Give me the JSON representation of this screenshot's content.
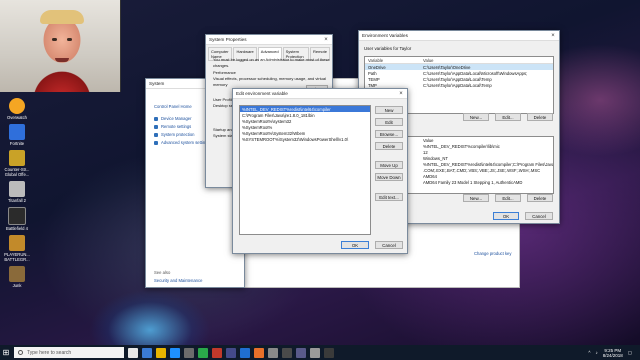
{
  "desktop_icons": [
    {
      "label": "Overwatch",
      "color": "#f5a623"
    },
    {
      "label": "Fortnite",
      "color": "#2f6fdb"
    },
    {
      "label": "Counter-Str... Global Offe...",
      "color": "#c9a227"
    },
    {
      "label": "Titanfall 2",
      "color": "#bcbcbc"
    },
    {
      "label": "Battlefield 4",
      "color": "#2b2b2b"
    },
    {
      "label": "PLAYERUN... BATTLEGR...",
      "color": "#c28a2a"
    },
    {
      "label": "Junk",
      "color": "#8a6a3a"
    }
  ],
  "system_window": {
    "title": "System",
    "home": "Control Panel Home",
    "nav": [
      "Device Manager",
      "Remote settings",
      "System protection",
      "Advanced system settings"
    ],
    "see_also": "See also",
    "security": "Security and Maintenance"
  },
  "sys_main": {
    "win_label": "Windows",
    "activation": "Windows",
    "change_key": "Change product key"
  },
  "system_properties": {
    "title": "System Properties",
    "tabs": [
      "Computer Name",
      "Hardware",
      "Advanced",
      "System Protection",
      "Remote"
    ],
    "note": "You must be logged on as an Administrator to make most of these changes.",
    "perf_label": "Performance",
    "perf_desc": "Visual effects, processor scheduling, memory usage, and virtual memory",
    "settings": "Settings...",
    "user_profiles": "User Profiles",
    "desktop_settings": "Desktop se...",
    "startup": "Startup and",
    "system_startup": "System start..."
  },
  "env_vars": {
    "title": "Environment Variables",
    "user_label": "User variables for Taylor",
    "col_variable": "Variable",
    "col_value": "Value",
    "user_rows": [
      {
        "var": "OneDrive",
        "val": "C:\\Users\\Taylor\\OneDrive",
        "selected": true
      },
      {
        "var": "Path",
        "val": "C:\\Users\\Taylor\\AppData\\Local\\Microsoft\\WindowsApps;",
        "selected": false
      },
      {
        "var": "TEMP",
        "val": "C:\\Users\\Taylor\\AppData\\Local\\Temp",
        "selected": false
      },
      {
        "var": "TMP",
        "val": "C:\\Users\\Taylor\\AppData\\Local\\Temp",
        "selected": false
      }
    ],
    "new": "New...",
    "edit": "Edit...",
    "delete": "Delete",
    "sys_rows": [
      {
        "var": "",
        "val": "Value"
      },
      {
        "var": "",
        "val": "%INTEL_DEV_REDIST%compiler\\lib\\mic"
      },
      {
        "var": "",
        "val": "12"
      },
      {
        "var": "",
        "val": "Windows_NT"
      },
      {
        "var": "",
        "val": "%INTEL_DEV_REDIST%redist\\intel64\\compiler;C:\\Program Files\\Java"
      },
      {
        "var": "",
        "val": ".COM;.EXE;.BAT;.CMD;.VBS;.VBE;.JS;.JSE;.WSF;.WSH;.MSC"
      },
      {
        "var": "TURE",
        "val": "AMD64"
      },
      {
        "var": "",
        "val": "AMD64 Family 23 Model 1 Stepping 1, AuthenticAMD"
      }
    ],
    "ok": "OK",
    "cancel": "Cancel"
  },
  "edit_env": {
    "title": "Edit environment variable",
    "entries": [
      {
        "text": "%INTEL_DEV_REDIST%redist\\intel64\\compiler",
        "selected": true
      },
      {
        "text": "C:\\Program Files\\Java\\jre1.8.0_181\\bin",
        "selected": false
      },
      {
        "text": "%SystemRoot%\\system32",
        "selected": false
      },
      {
        "text": "%SystemRoot%",
        "selected": false
      },
      {
        "text": "%SystemRoot%\\System32\\Wbem",
        "selected": false
      },
      {
        "text": "%SYSTEMROOT%\\System32\\WindowsPowerShell\\v1.0\\",
        "selected": false
      }
    ],
    "buttons": {
      "new": "New",
      "edit": "Edit",
      "browse": "Browse...",
      "delete": "Delete",
      "move_up": "Move Up",
      "move_down": "Move Down",
      "edit_text": "Edit text..."
    },
    "ok": "OK",
    "cancel": "Cancel"
  },
  "taskbar": {
    "search_placeholder": "Type here to search",
    "time": "9:25 PM",
    "date": "8/24/2018",
    "apps": [
      "#e8e8e8",
      "#3a7bd5",
      "#e8b400",
      "#1e90ff",
      "#6c6c6c",
      "#2aa84a",
      "#c1392b",
      "#444a8a",
      "#1f6fd1",
      "#e8702a",
      "#8a8a8a",
      "#4a4a4a",
      "#5a5a8a",
      "#9a9a9a",
      "#3a3a3a"
    ]
  }
}
